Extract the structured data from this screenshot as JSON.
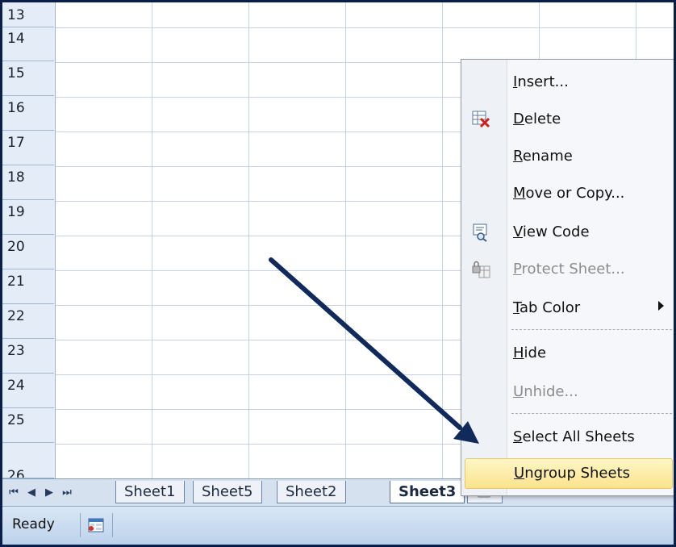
{
  "rows": [
    "13",
    "14",
    "15",
    "16",
    "17",
    "18",
    "19",
    "20",
    "21",
    "22",
    "23",
    "24",
    "25"
  ],
  "partial_row": "26",
  "sheet_nav": [
    "⏮",
    "◀",
    "▶",
    "⏭"
  ],
  "tabs": [
    {
      "label": "Sheet1",
      "active": false
    },
    {
      "label": "Sheet5",
      "active": false
    },
    {
      "label": "Sheet2",
      "active": false
    },
    {
      "label": "Sheet3",
      "active": true
    }
  ],
  "status": {
    "ready": "Ready"
  },
  "menu": {
    "items": [
      {
        "label": "Insert...",
        "ul": "I",
        "rest": "nsert...",
        "disabled": false
      },
      {
        "label": "Delete",
        "ul": "D",
        "rest": "elete",
        "disabled": false,
        "icon": "delete-sheet-icon"
      },
      {
        "label": "Rename",
        "ul": "R",
        "rest": "ename",
        "disabled": false
      },
      {
        "label": "Move or Copy...",
        "ul": "M",
        "rest": "ove or Copy...",
        "disabled": false
      },
      {
        "label": "View Code",
        "ul": "V",
        "rest": "iew Code",
        "disabled": false,
        "icon": "view-code-icon"
      },
      {
        "label": "Protect Sheet...",
        "ul": "P",
        "rest": "rotect Sheet...",
        "disabled": true,
        "icon": "protect-sheet-icon"
      },
      {
        "label": "Tab Color",
        "ul": "T",
        "rest": "ab Color",
        "disabled": false,
        "submenu": true
      },
      {
        "label": "Hide",
        "ul": "H",
        "rest": "ide",
        "disabled": false
      },
      {
        "label": "Unhide...",
        "ul": "U",
        "rest": "nhide...",
        "disabled": true
      },
      {
        "label": "Select All Sheets",
        "ul": "S",
        "rest": "elect All Sheets",
        "disabled": false
      },
      {
        "label": "Ungroup Sheets",
        "ul": "U",
        "rest": "ngroup Sheets",
        "disabled": false,
        "highlighted": true
      }
    ]
  },
  "colors": {
    "accent_highlight": "#fbe38d",
    "arrow": "#102a5c"
  }
}
